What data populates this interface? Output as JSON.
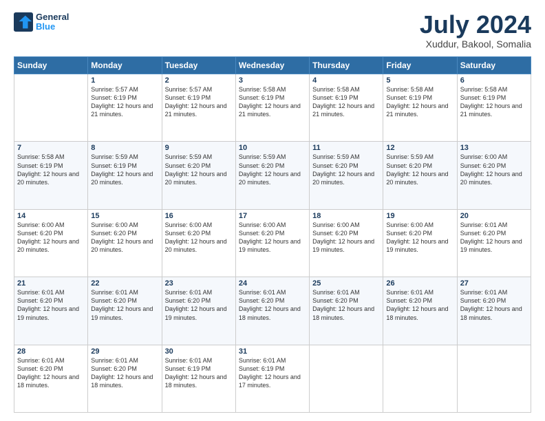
{
  "header": {
    "logo_line1": "General",
    "logo_line2": "Blue",
    "title": "July 2024",
    "subtitle": "Xuddur, Bakool, Somalia"
  },
  "weekdays": [
    "Sunday",
    "Monday",
    "Tuesday",
    "Wednesday",
    "Thursday",
    "Friday",
    "Saturday"
  ],
  "weeks": [
    [
      {
        "day": "",
        "sunrise": "",
        "sunset": "",
        "daylight": ""
      },
      {
        "day": "1",
        "sunrise": "Sunrise: 5:57 AM",
        "sunset": "Sunset: 6:19 PM",
        "daylight": "Daylight: 12 hours and 21 minutes."
      },
      {
        "day": "2",
        "sunrise": "Sunrise: 5:57 AM",
        "sunset": "Sunset: 6:19 PM",
        "daylight": "Daylight: 12 hours and 21 minutes."
      },
      {
        "day": "3",
        "sunrise": "Sunrise: 5:58 AM",
        "sunset": "Sunset: 6:19 PM",
        "daylight": "Daylight: 12 hours and 21 minutes."
      },
      {
        "day": "4",
        "sunrise": "Sunrise: 5:58 AM",
        "sunset": "Sunset: 6:19 PM",
        "daylight": "Daylight: 12 hours and 21 minutes."
      },
      {
        "day": "5",
        "sunrise": "Sunrise: 5:58 AM",
        "sunset": "Sunset: 6:19 PM",
        "daylight": "Daylight: 12 hours and 21 minutes."
      },
      {
        "day": "6",
        "sunrise": "Sunrise: 5:58 AM",
        "sunset": "Sunset: 6:19 PM",
        "daylight": "Daylight: 12 hours and 21 minutes."
      }
    ],
    [
      {
        "day": "7",
        "sunrise": "Sunrise: 5:58 AM",
        "sunset": "Sunset: 6:19 PM",
        "daylight": "Daylight: 12 hours and 20 minutes."
      },
      {
        "day": "8",
        "sunrise": "Sunrise: 5:59 AM",
        "sunset": "Sunset: 6:19 PM",
        "daylight": "Daylight: 12 hours and 20 minutes."
      },
      {
        "day": "9",
        "sunrise": "Sunrise: 5:59 AM",
        "sunset": "Sunset: 6:20 PM",
        "daylight": "Daylight: 12 hours and 20 minutes."
      },
      {
        "day": "10",
        "sunrise": "Sunrise: 5:59 AM",
        "sunset": "Sunset: 6:20 PM",
        "daylight": "Daylight: 12 hours and 20 minutes."
      },
      {
        "day": "11",
        "sunrise": "Sunrise: 5:59 AM",
        "sunset": "Sunset: 6:20 PM",
        "daylight": "Daylight: 12 hours and 20 minutes."
      },
      {
        "day": "12",
        "sunrise": "Sunrise: 5:59 AM",
        "sunset": "Sunset: 6:20 PM",
        "daylight": "Daylight: 12 hours and 20 minutes."
      },
      {
        "day": "13",
        "sunrise": "Sunrise: 6:00 AM",
        "sunset": "Sunset: 6:20 PM",
        "daylight": "Daylight: 12 hours and 20 minutes."
      }
    ],
    [
      {
        "day": "14",
        "sunrise": "Sunrise: 6:00 AM",
        "sunset": "Sunset: 6:20 PM",
        "daylight": "Daylight: 12 hours and 20 minutes."
      },
      {
        "day": "15",
        "sunrise": "Sunrise: 6:00 AM",
        "sunset": "Sunset: 6:20 PM",
        "daylight": "Daylight: 12 hours and 20 minutes."
      },
      {
        "day": "16",
        "sunrise": "Sunrise: 6:00 AM",
        "sunset": "Sunset: 6:20 PM",
        "daylight": "Daylight: 12 hours and 20 minutes."
      },
      {
        "day": "17",
        "sunrise": "Sunrise: 6:00 AM",
        "sunset": "Sunset: 6:20 PM",
        "daylight": "Daylight: 12 hours and 19 minutes."
      },
      {
        "day": "18",
        "sunrise": "Sunrise: 6:00 AM",
        "sunset": "Sunset: 6:20 PM",
        "daylight": "Daylight: 12 hours and 19 minutes."
      },
      {
        "day": "19",
        "sunrise": "Sunrise: 6:00 AM",
        "sunset": "Sunset: 6:20 PM",
        "daylight": "Daylight: 12 hours and 19 minutes."
      },
      {
        "day": "20",
        "sunrise": "Sunrise: 6:01 AM",
        "sunset": "Sunset: 6:20 PM",
        "daylight": "Daylight: 12 hours and 19 minutes."
      }
    ],
    [
      {
        "day": "21",
        "sunrise": "Sunrise: 6:01 AM",
        "sunset": "Sunset: 6:20 PM",
        "daylight": "Daylight: 12 hours and 19 minutes."
      },
      {
        "day": "22",
        "sunrise": "Sunrise: 6:01 AM",
        "sunset": "Sunset: 6:20 PM",
        "daylight": "Daylight: 12 hours and 19 minutes."
      },
      {
        "day": "23",
        "sunrise": "Sunrise: 6:01 AM",
        "sunset": "Sunset: 6:20 PM",
        "daylight": "Daylight: 12 hours and 19 minutes."
      },
      {
        "day": "24",
        "sunrise": "Sunrise: 6:01 AM",
        "sunset": "Sunset: 6:20 PM",
        "daylight": "Daylight: 12 hours and 18 minutes."
      },
      {
        "day": "25",
        "sunrise": "Sunrise: 6:01 AM",
        "sunset": "Sunset: 6:20 PM",
        "daylight": "Daylight: 12 hours and 18 minutes."
      },
      {
        "day": "26",
        "sunrise": "Sunrise: 6:01 AM",
        "sunset": "Sunset: 6:20 PM",
        "daylight": "Daylight: 12 hours and 18 minutes."
      },
      {
        "day": "27",
        "sunrise": "Sunrise: 6:01 AM",
        "sunset": "Sunset: 6:20 PM",
        "daylight": "Daylight: 12 hours and 18 minutes."
      }
    ],
    [
      {
        "day": "28",
        "sunrise": "Sunrise: 6:01 AM",
        "sunset": "Sunset: 6:20 PM",
        "daylight": "Daylight: 12 hours and 18 minutes."
      },
      {
        "day": "29",
        "sunrise": "Sunrise: 6:01 AM",
        "sunset": "Sunset: 6:20 PM",
        "daylight": "Daylight: 12 hours and 18 minutes."
      },
      {
        "day": "30",
        "sunrise": "Sunrise: 6:01 AM",
        "sunset": "Sunset: 6:19 PM",
        "daylight": "Daylight: 12 hours and 18 minutes."
      },
      {
        "day": "31",
        "sunrise": "Sunrise: 6:01 AM",
        "sunset": "Sunset: 6:19 PM",
        "daylight": "Daylight: 12 hours and 17 minutes."
      },
      {
        "day": "",
        "sunrise": "",
        "sunset": "",
        "daylight": ""
      },
      {
        "day": "",
        "sunrise": "",
        "sunset": "",
        "daylight": ""
      },
      {
        "day": "",
        "sunrise": "",
        "sunset": "",
        "daylight": ""
      }
    ]
  ]
}
